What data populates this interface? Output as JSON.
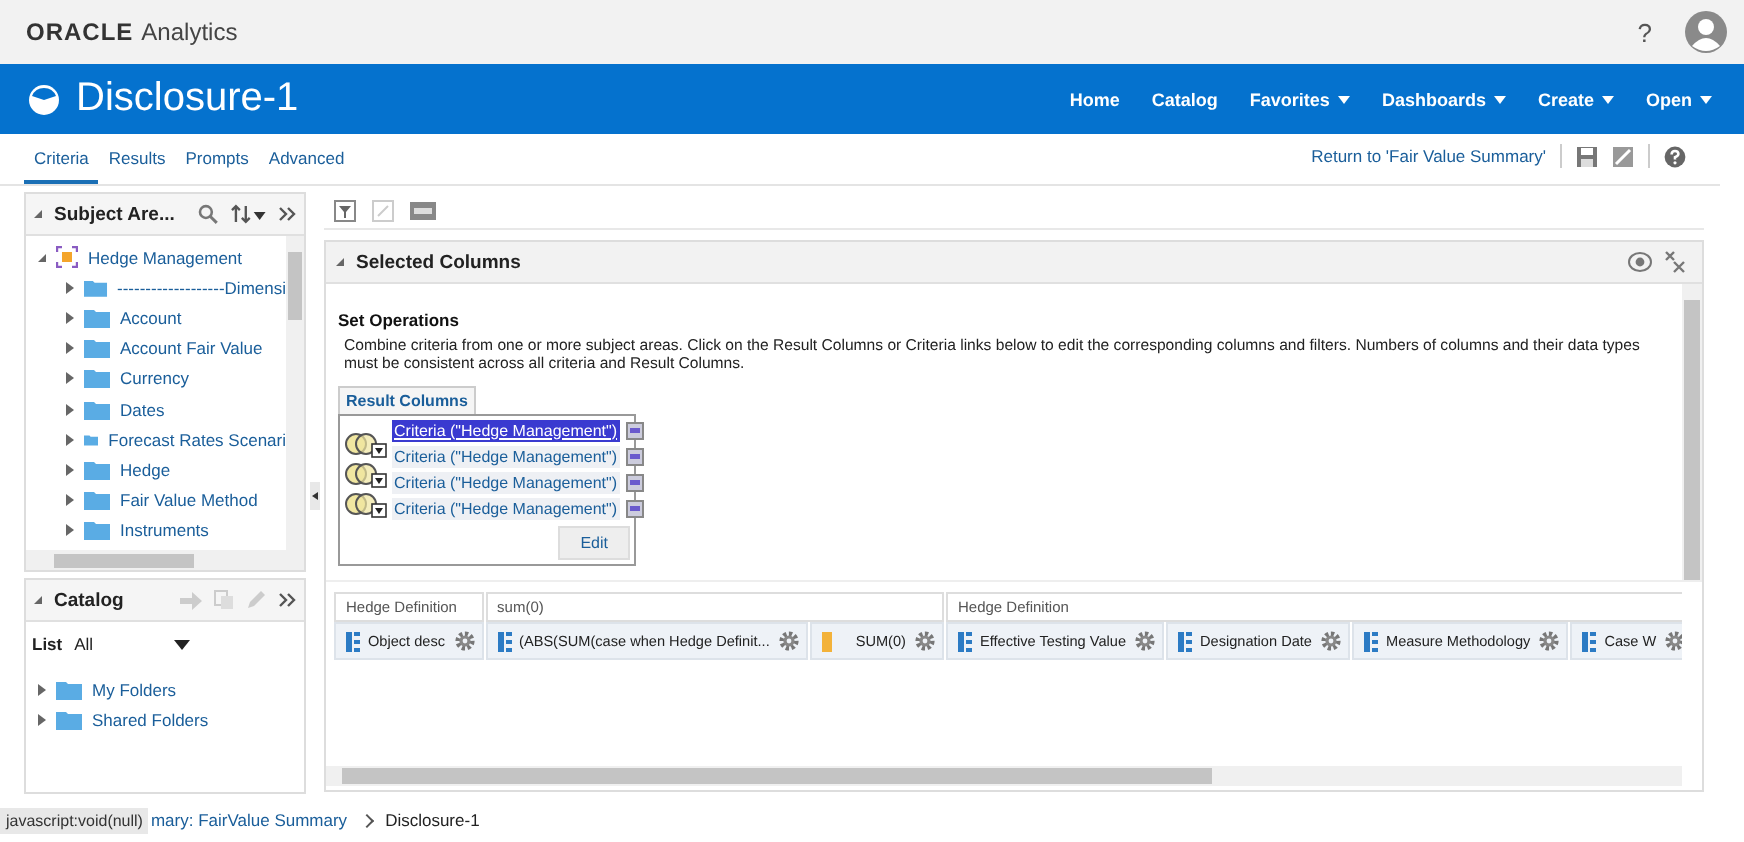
{
  "brand": {
    "logo": "ORACLE",
    "product": "Analytics"
  },
  "header": {
    "help": "?"
  },
  "title_bar": {
    "title": "Disclosure-1",
    "nav": [
      {
        "label": "Home",
        "dropdown": false
      },
      {
        "label": "Catalog",
        "dropdown": false
      },
      {
        "label": "Favorites",
        "dropdown": true
      },
      {
        "label": "Dashboards",
        "dropdown": true
      },
      {
        "label": "Create",
        "dropdown": true
      },
      {
        "label": "Open",
        "dropdown": true
      }
    ]
  },
  "tabs": [
    {
      "label": "Criteria",
      "selected": true
    },
    {
      "label": "Results",
      "selected": false
    },
    {
      "label": "Prompts",
      "selected": false
    },
    {
      "label": "Advanced",
      "selected": false
    }
  ],
  "return_link": "Return to 'Fair Value Summary'",
  "subject_areas": {
    "title": "Subject Are...",
    "root": {
      "label": "Hedge Management",
      "expanded": true,
      "children": [
        {
          "label": "-------------------Dimensi",
          "expanded": false
        },
        {
          "label": "Account",
          "expanded": false
        },
        {
          "label": "Account Fair Value",
          "expanded": false
        },
        {
          "label": "Currency",
          "expanded": false
        },
        {
          "label": "Dates",
          "expanded": false
        },
        {
          "label": "Forecast Rates Scenari",
          "expanded": false
        },
        {
          "label": "Hedge",
          "expanded": false
        },
        {
          "label": "Fair Value Method",
          "expanded": false
        },
        {
          "label": "Instruments",
          "expanded": false
        }
      ]
    }
  },
  "catalog": {
    "title": "Catalog",
    "list_label": "List",
    "list_value": "All",
    "folders": [
      {
        "label": "My Folders",
        "expanded": false
      },
      {
        "label": "Shared Folders",
        "expanded": false
      }
    ]
  },
  "selected_columns": {
    "title": "Selected Columns",
    "set_operations": {
      "heading": "Set Operations",
      "description": "Combine criteria from one or more subject areas. Click on the Result Columns or Criteria links below to edit the corresponding columns and filters. Numbers of columns and their data types must be consistent across all criteria and Result Columns."
    },
    "result_columns_tab": "Result Columns",
    "criteria": [
      {
        "label": "Criteria (\"Hedge Management\")",
        "selected": true
      },
      {
        "label": "Criteria (\"Hedge Management\")",
        "selected": false
      },
      {
        "label": "Criteria (\"Hedge Management\")",
        "selected": false
      },
      {
        "label": "Criteria (\"Hedge Management\")",
        "selected": false
      }
    ],
    "edit_button": "Edit"
  },
  "column_groups": [
    {
      "heading": "Hedge Definition",
      "columns": [
        {
          "label": "Object desc",
          "kind": "attribute"
        }
      ]
    },
    {
      "heading": "sum(0)",
      "columns": [
        {
          "label": "(ABS(SUM(case when Hedge Definit...",
          "kind": "attribute"
        },
        {
          "label": "SUM(0)",
          "kind": "measure"
        }
      ]
    },
    {
      "heading": "Hedge Definition",
      "columns": [
        {
          "label": "Effective Testing Value",
          "kind": "attribute"
        },
        {
          "label": "Designation Date",
          "kind": "attribute"
        },
        {
          "label": "Measure Methodology",
          "kind": "attribute"
        },
        {
          "label": "Case W",
          "kind": "attribute"
        }
      ]
    }
  ],
  "status": {
    "tooltip": "javascript:void(null)",
    "breadcrumb": [
      {
        "label": "mary: FairValue Summary",
        "kind": "link"
      },
      {
        "label": "Disclosure-1",
        "kind": "current"
      }
    ]
  }
}
